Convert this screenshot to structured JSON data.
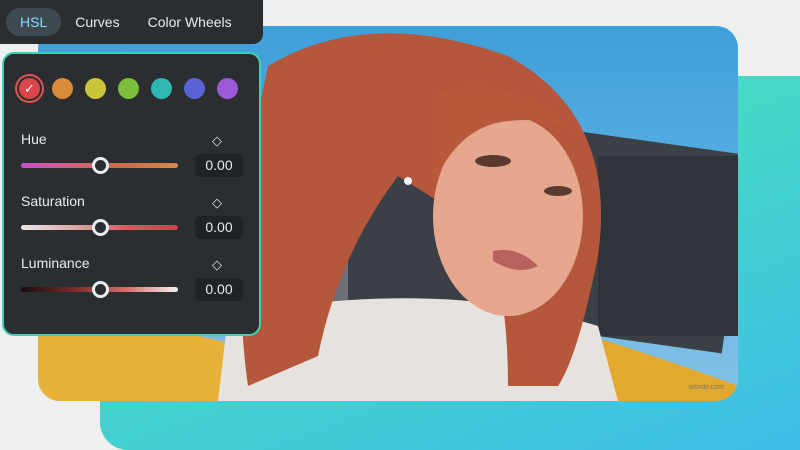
{
  "tabs": [
    {
      "label": "HSL",
      "active": true
    },
    {
      "label": "Curves",
      "active": false
    },
    {
      "label": "Color Wheels",
      "active": false
    }
  ],
  "swatches": [
    {
      "name": "red",
      "color": "#d9474d",
      "selected": true
    },
    {
      "name": "orange",
      "color": "#d98b3a",
      "selected": false
    },
    {
      "name": "yellow",
      "color": "#c9c43a",
      "selected": false
    },
    {
      "name": "green",
      "color": "#7cbd3a",
      "selected": false
    },
    {
      "name": "aqua",
      "color": "#2fb7b3",
      "selected": false
    },
    {
      "name": "blue",
      "color": "#5a63d6",
      "selected": false
    },
    {
      "name": "purple",
      "color": "#9a59d6",
      "selected": false
    }
  ],
  "check_glyph": "✓",
  "keyframe_glyph": "◇",
  "sliders": [
    {
      "label": "Hue",
      "value": "0.00",
      "position": 0.5,
      "gradient": [
        "#c94fd0",
        "#d4617a",
        "#cf6b4a",
        "#d88a4d"
      ]
    },
    {
      "label": "Saturation",
      "value": "0.00",
      "position": 0.5,
      "gradient": [
        "#e8e8e8",
        "#d9aaa8",
        "#d95a5f",
        "#d93a48"
      ]
    },
    {
      "label": "Luminance",
      "value": "0.00",
      "position": 0.5,
      "gradient": [
        "#1a0d0d",
        "#7a2a2a",
        "#d96b6b",
        "#f2f2f2"
      ]
    }
  ],
  "watermark": "wsxdn.com",
  "colors": {
    "accent_border": "#3fd1b5",
    "panel_bg": "#2b2e31",
    "active_tab_text": "#7fdcff"
  }
}
